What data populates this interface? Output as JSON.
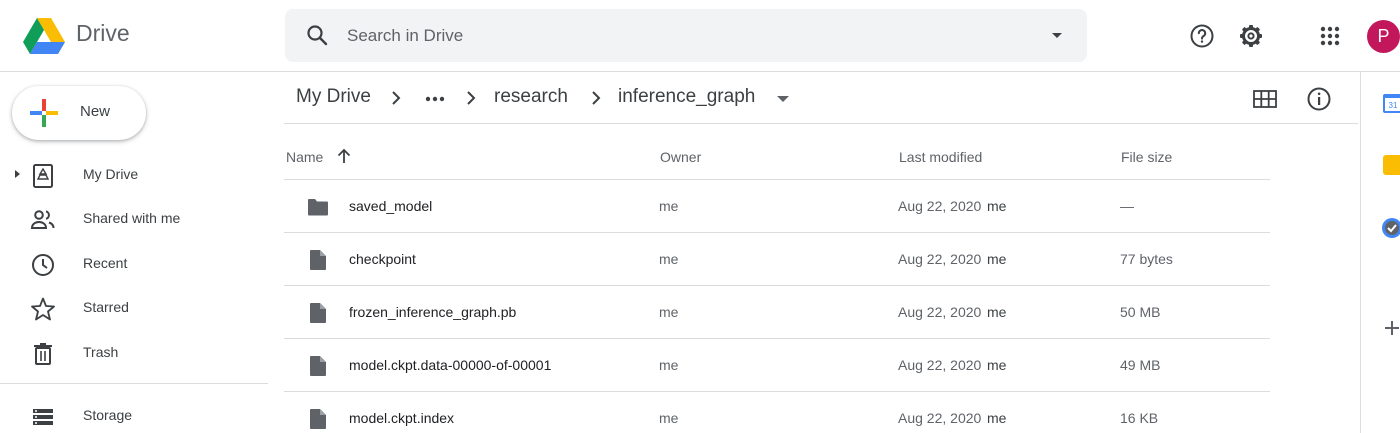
{
  "app": {
    "name": "Drive"
  },
  "search": {
    "placeholder": "Search in Drive"
  },
  "header": {
    "avatar_letter": "P",
    "avatar_color": "#c2185b"
  },
  "sidebar": {
    "new_label": "New",
    "items": [
      {
        "label": "My Drive",
        "icon": "my-drive-icon"
      },
      {
        "label": "Shared with me",
        "icon": "people-icon"
      },
      {
        "label": "Recent",
        "icon": "clock-icon"
      },
      {
        "label": "Starred",
        "icon": "star-icon"
      },
      {
        "label": "Trash",
        "icon": "trash-icon"
      },
      {
        "label": "Storage",
        "icon": "storage-icon"
      }
    ]
  },
  "breadcrumb": {
    "items": [
      "My Drive",
      "research",
      "inference_graph"
    ]
  },
  "table": {
    "columns": [
      "Name",
      "Owner",
      "Last modified",
      "File size"
    ],
    "rows": [
      {
        "name": "saved_model",
        "type": "folder",
        "owner": "me",
        "modified": "Aug 22, 2020",
        "modified_by": "me",
        "size": "—"
      },
      {
        "name": "checkpoint",
        "type": "file",
        "owner": "me",
        "modified": "Aug 22, 2020",
        "modified_by": "me",
        "size": "77 bytes"
      },
      {
        "name": "frozen_inference_graph.pb",
        "type": "file",
        "owner": "me",
        "modified": "Aug 22, 2020",
        "modified_by": "me",
        "size": "50 MB"
      },
      {
        "name": "model.ckpt.data-00000-of-00001",
        "type": "file",
        "owner": "me",
        "modified": "Aug 22, 2020",
        "modified_by": "me",
        "size": "49 MB"
      },
      {
        "name": "model.ckpt.index",
        "type": "file",
        "owner": "me",
        "modified": "Aug 22, 2020",
        "modified_by": "me",
        "size": "16 KB"
      }
    ]
  },
  "side_panel": {
    "calendar_badge": "31"
  }
}
